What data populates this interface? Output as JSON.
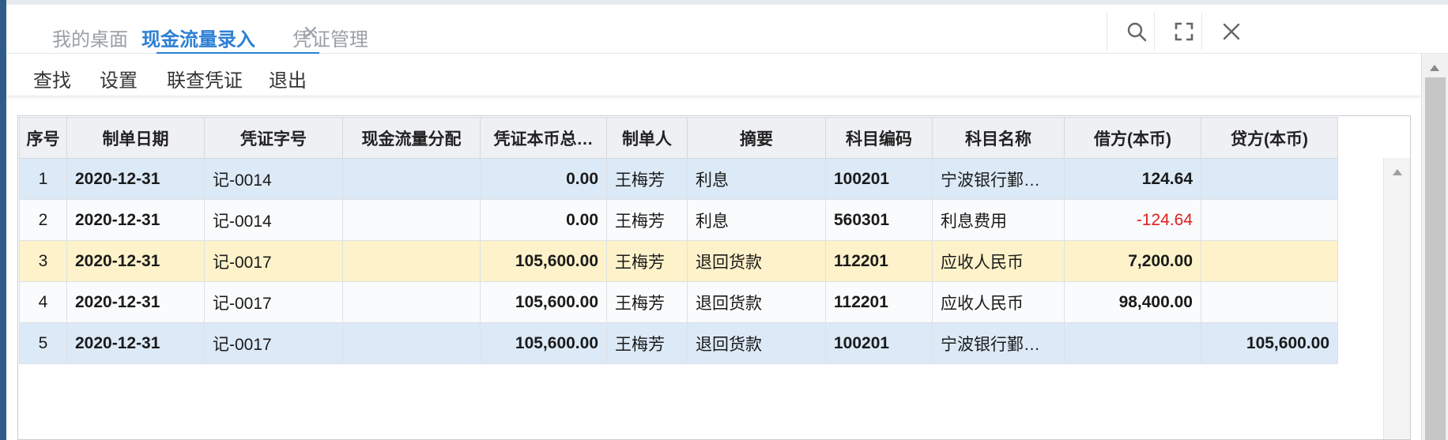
{
  "tabs": [
    {
      "label": "我的桌面",
      "active": false
    },
    {
      "label": "现金流量录入",
      "active": true
    },
    {
      "label": "凭证管理",
      "active": false
    }
  ],
  "tab_close_glyph": "×",
  "window_buttons": [
    "search-icon",
    "fullscreen-icon",
    "close-icon"
  ],
  "menu": {
    "items": [
      "查找",
      "设置",
      "联查凭证",
      "退出"
    ]
  },
  "grid": {
    "columns": [
      "序号",
      "制单日期",
      "凭证字号",
      "现金流量分配",
      "凭证本币总…",
      "制单人",
      "摘要",
      "科目编码",
      "科目名称",
      "借方(本币)",
      "贷方(本币)"
    ],
    "rows": [
      {
        "no": "1",
        "date": "2020-12-31",
        "voucher": "记-0014",
        "alloc": "",
        "total": "0.00",
        "maker": "王梅芳",
        "summary": "利息",
        "code": "100201",
        "name": "宁波银行鄞…",
        "debit": "124.64",
        "credit": "",
        "style": "blue",
        "debit_negative": false
      },
      {
        "no": "2",
        "date": "2020-12-31",
        "voucher": "记-0014",
        "alloc": "",
        "total": "0.00",
        "maker": "王梅芳",
        "summary": "利息",
        "code": "560301",
        "name": "利息费用",
        "debit": "-124.64",
        "credit": "",
        "style": "white",
        "debit_negative": true
      },
      {
        "no": "3",
        "date": "2020-12-31",
        "voucher": "记-0017",
        "alloc": "",
        "total": "105,600.00",
        "maker": "王梅芳",
        "summary": "退回货款",
        "code": "112201",
        "name": "应收人民币",
        "debit": "7,200.00",
        "credit": "",
        "style": "yellow",
        "debit_negative": false
      },
      {
        "no": "4",
        "date": "2020-12-31",
        "voucher": "记-0017",
        "alloc": "",
        "total": "105,600.00",
        "maker": "王梅芳",
        "summary": "退回货款",
        "code": "112201",
        "name": "应收人民币",
        "debit": "98,400.00",
        "credit": "",
        "style": "white",
        "debit_negative": false
      },
      {
        "no": "5",
        "date": "2020-12-31",
        "voucher": "记-0017",
        "alloc": "",
        "total": "105,600.00",
        "maker": "王梅芳",
        "summary": "退回货款",
        "code": "100201",
        "name": "宁波银行鄞…",
        "debit": "",
        "credit": "105,600.00",
        "style": "blue",
        "debit_negative": false
      }
    ]
  },
  "colors": {
    "accent": "#2d7fd3",
    "negative": "#e02020",
    "row_selected": "#dce9f7",
    "row_highlight": "#fdf2c9"
  }
}
